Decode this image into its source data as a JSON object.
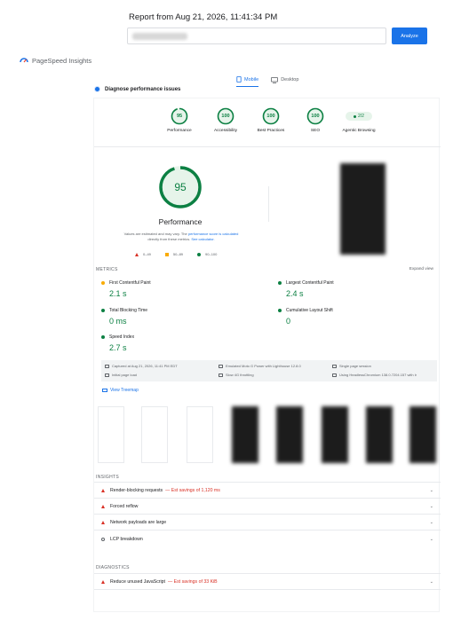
{
  "header": {
    "report_title": "Report from Aug 21, 2026, 11:41:34 PM",
    "url_value": "",
    "analyze_label": "Analyze"
  },
  "brand": {
    "name": "PageSpeed Insights"
  },
  "tabs": [
    {
      "label": "Mobile",
      "active": true
    },
    {
      "label": "Desktop",
      "active": false
    }
  ],
  "section": {
    "title": "Diagnose performance issues"
  },
  "categories": [
    {
      "label": "Performance",
      "score": "95"
    },
    {
      "label": "Accessibility",
      "score": "100"
    },
    {
      "label": "Best Practices",
      "score": "100"
    },
    {
      "label": "SEO",
      "score": "100"
    },
    {
      "label": "Agentic Browsing",
      "score": "2/2"
    }
  ],
  "performance": {
    "score": "95",
    "title": "Performance",
    "note_text": "Values are estimated and may vary. The",
    "note_link": "performance score is calculated",
    "note_text2": "directly from these metrics.",
    "note_link2": "See calculator.",
    "legend": [
      "0–49",
      "50–89",
      "90–100"
    ]
  },
  "metrics": {
    "label": "METRICS",
    "expand": "Expand view",
    "items": [
      {
        "name": "First Contentful Paint",
        "value": "2.1 s",
        "status": "average"
      },
      {
        "name": "Largest Contentful Paint",
        "value": "2.4 s",
        "status": "good"
      },
      {
        "name": "Total Blocking Time",
        "value": "0 ms",
        "status": "good"
      },
      {
        "name": "Cumulative Layout Shift",
        "value": "0",
        "status": "good"
      },
      {
        "name": "Speed Index",
        "value": "2.7 s",
        "status": "good"
      }
    ]
  },
  "meta": [
    "Captured at Aug 21, 2026, 11:41 PM EDT",
    "Emulated Moto G Power with Lighthouse 12.8.0",
    "Single page session",
    "Initial page load",
    "Slow 4G throttling",
    "Using HeadlessChromium 138.0.7204.157 with lr"
  ],
  "treemap_label": "View Treemap",
  "insights": {
    "label": "INSIGHTS",
    "items": [
      {
        "text": "Render-blocking requests",
        "savings": "— Est savings of 1,120 ms",
        "icon": "red-triangle-icon"
      },
      {
        "text": "Forced reflow",
        "savings": "",
        "icon": "red-triangle-icon"
      },
      {
        "text": "Network payloads are large",
        "savings": "",
        "icon": "red-triangle-icon"
      },
      {
        "text": "LCP breakdown",
        "savings": "",
        "icon": "empty-circle-icon"
      }
    ]
  },
  "diagnostics": {
    "label": "DIAGNOSTICS",
    "items": [
      {
        "text": "Reduce unused JavaScript",
        "savings": "— Est savings of 33 KiB",
        "icon": "red-triangle-icon"
      }
    ]
  },
  "colors": {
    "good": "#0c8043",
    "average": "#f9ab00",
    "poor": "#d93025",
    "accent": "#1a73e8"
  }
}
